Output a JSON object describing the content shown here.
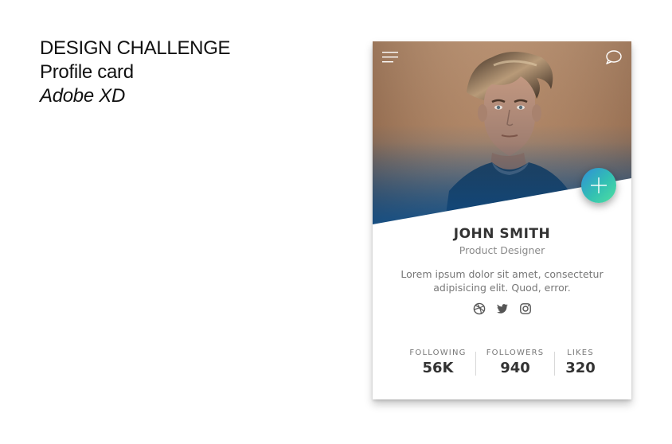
{
  "caption": {
    "line1": "DESIGN CHALLENGE",
    "line2": "Profile card",
    "line3": "Adobe XD"
  },
  "card": {
    "menu_icon": "hamburger-menu-icon",
    "chat_icon": "chat-bubble-icon",
    "fab_icon": "plus-icon",
    "accent_gradient": [
      "#2f8fd8",
      "#33c0b2",
      "#4fe0a0"
    ],
    "name": "JOHN SMITH",
    "role": "Product Designer",
    "bio": "Lorem ipsum dolor sit amet, consectetur adipisicing elit. Quod, error.",
    "socials": [
      "dribbble-icon",
      "twitter-icon",
      "instagram-icon"
    ],
    "stats": [
      {
        "label": "FOLLOWING",
        "value": "56K"
      },
      {
        "label": "FOLLOWERS",
        "value": "940"
      },
      {
        "label": "LIKES",
        "value": "320"
      }
    ]
  }
}
